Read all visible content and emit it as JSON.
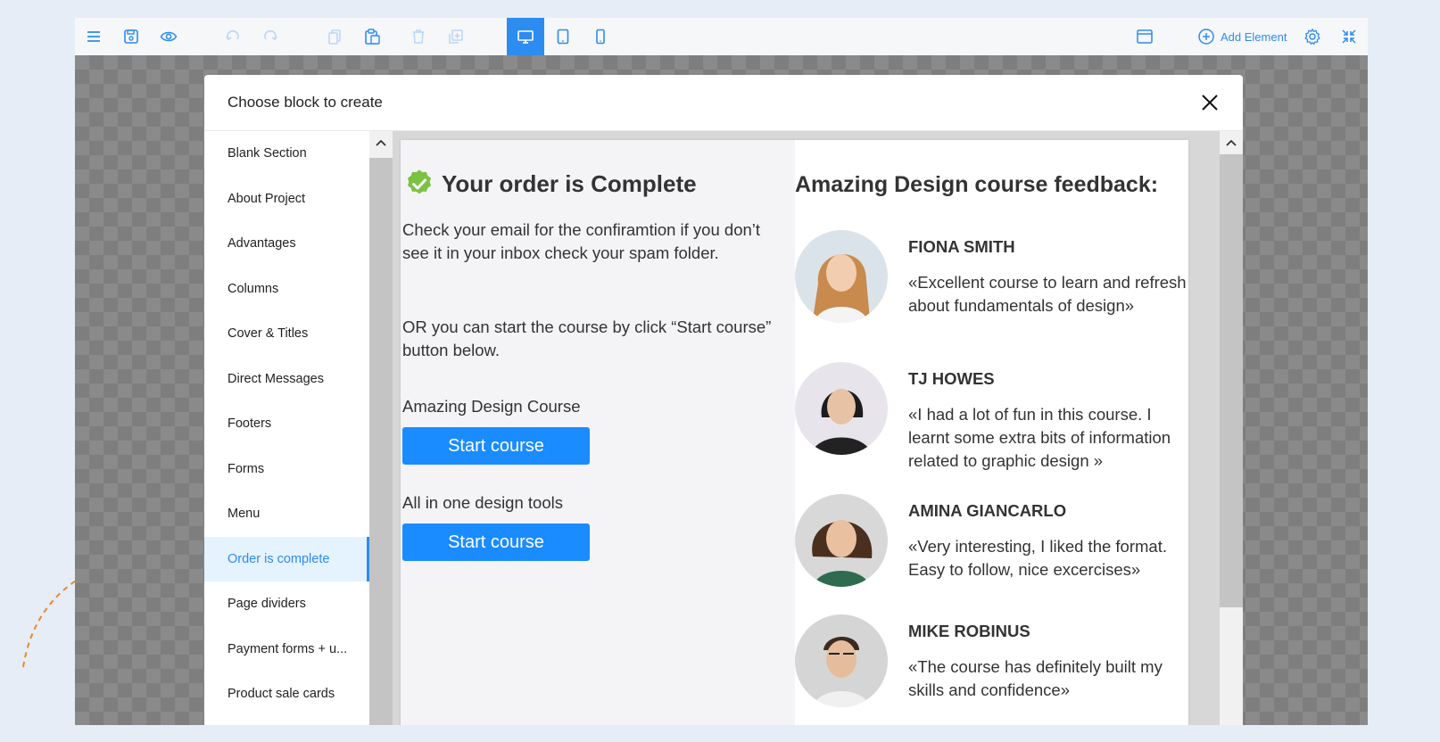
{
  "toolbar": {
    "add_element_label": "Add Element",
    "icons": [
      "menu-icon",
      "save-icon",
      "preview-icon",
      "undo-icon",
      "redo-icon",
      "copy-icon",
      "paste-icon",
      "delete-icon",
      "duplicate-icon",
      "desktop-icon",
      "tablet-icon",
      "mobile-icon",
      "browser-window-icon",
      "add-circle-icon",
      "gear-icon",
      "collapse-icon"
    ],
    "active_device": "desktop"
  },
  "modal": {
    "title": "Choose block to create",
    "sidebar_items": [
      {
        "label": "Blank Section"
      },
      {
        "label": "About Project"
      },
      {
        "label": "Advantages"
      },
      {
        "label": "Columns"
      },
      {
        "label": "Cover & Titles"
      },
      {
        "label": "Direct Messages"
      },
      {
        "label": "Footers"
      },
      {
        "label": "Forms"
      },
      {
        "label": "Menu"
      },
      {
        "label": "Order is complete",
        "active": true
      },
      {
        "label": "Page dividers"
      },
      {
        "label": "Payment forms + u..."
      },
      {
        "label": "Product sale cards"
      }
    ]
  },
  "preview": {
    "order_title": "Your order is Complete",
    "check_email_text": "Check your email for the confiramtion if you don’t see it in your inbox check your spam folder.",
    "or_text": "OR you can start the course by click “Start course” button below.",
    "course1_label": "Amazing Design Course",
    "course1_button": "Start course",
    "course2_label": "All in one design tools",
    "course2_button": "Start course",
    "feedback_title": "Amazing Design course feedback:",
    "testimonials": [
      {
        "name": "FIONA SMITH",
        "quote": "«Excellent course to learn and refresh about fundamentals of design»"
      },
      {
        "name": "TJ HOWES",
        "quote": "«I had a lot of fun in this course. I learnt some extra bits of information related to graphic design »"
      },
      {
        "name": "AMINA GIANCARLO",
        "quote": "«Very interesting, I liked the format. Easy to follow, nice excercises»"
      },
      {
        "name": "MIKE ROBINUS",
        "quote": "«The course has definitely built my skills and confidence»"
      }
    ]
  },
  "colors": {
    "accent": "#2d8cf0",
    "button": "#1a8cff",
    "badge": "#7cc242",
    "deco_curve": "#e88a2d"
  }
}
